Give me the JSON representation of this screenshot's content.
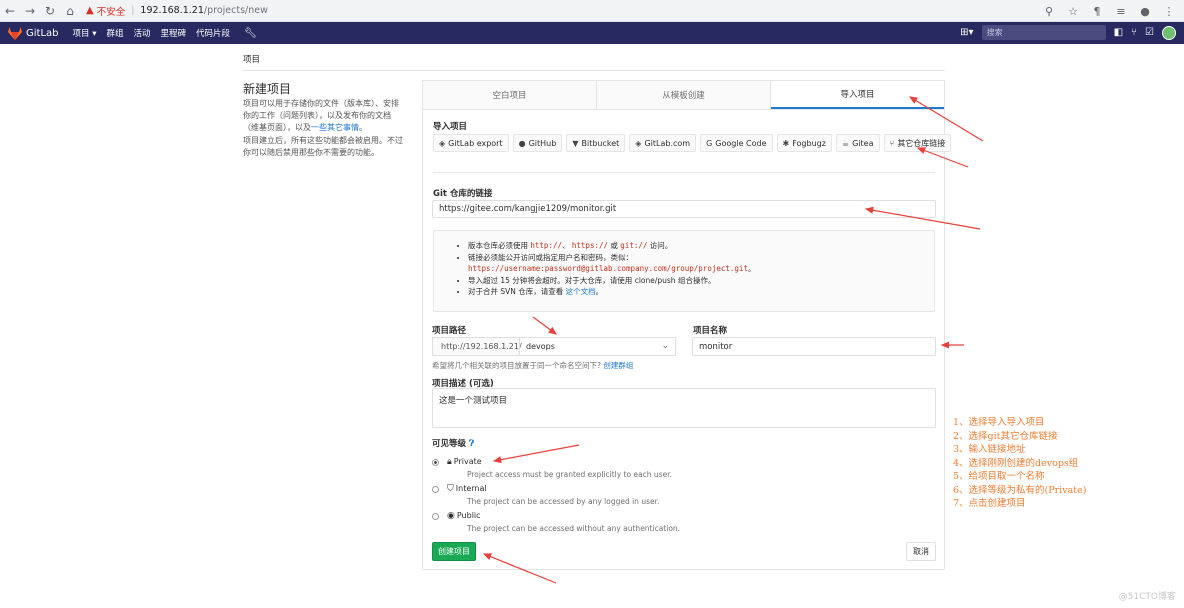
{
  "browser": {
    "insecure_label": "不安全",
    "url_host": "192.168.1.21",
    "url_path": "/projects/new"
  },
  "header": {
    "brand": "GitLab",
    "nav": [
      "项目 ▾",
      "群组",
      "活动",
      "里程碑",
      "代码片段"
    ],
    "search_placeholder": "搜索"
  },
  "breadcrumb": "项目",
  "left": {
    "title": "新建项目",
    "desc": "项目可以用于存储你的文件（版本库）、安排你的工作（问题列表），以及发布你的文档（维基页面），以及",
    "desc_link": "一些其它事情",
    "desc_end": "。",
    "desc2": "项目建立后，所有这些功能都会被启用。不过你可以随后禁用那些你不需要的功能。"
  },
  "tabs": [
    {
      "label": "空白项目",
      "active": false
    },
    {
      "label": "从模板创建",
      "active": false
    },
    {
      "label": "导入项目",
      "active": true
    }
  ],
  "import": {
    "label": "导入项目",
    "buttons": [
      {
        "label": "GitLab export",
        "icon": "gitlab-icon"
      },
      {
        "label": "GitHub",
        "icon": "github-icon"
      },
      {
        "label": "Bitbucket",
        "icon": "bitbucket-icon"
      },
      {
        "label": "GitLab.com",
        "icon": "gitlab-icon"
      },
      {
        "label": "Google Code",
        "icon": "google-icon"
      },
      {
        "label": "Fogbugz",
        "icon": "bug-icon"
      },
      {
        "label": "Gitea",
        "icon": "gitea-icon"
      },
      {
        "label": "其它仓库链接",
        "icon": "git-icon"
      }
    ]
  },
  "git_url": {
    "label": "Git 仓库的链接",
    "value": "https://gitee.com/kangjie1209/monitor.git"
  },
  "info": {
    "l1_a": "版本仓库必须使用",
    "l1_c1": "http://",
    "l1_b": "、",
    "l1_c2": "https://",
    "l1_c": "或",
    "l1_c3": "git://",
    "l1_d": "访问。",
    "l2": "链接必须能公开访问或指定用户名和密码，类似：",
    "l2_code": "https://username:password@gitlab.company.com/group/project.git",
    "l2_end": "。",
    "l3": "导入超过 15 分钟将会超时。对于大仓库，请使用 clone/push 组合操作。",
    "l4": "对于合并 SVN 仓库，请查看",
    "l4_link": "这个文档",
    "l4_end": "。"
  },
  "path": {
    "label": "项目路径",
    "prefix": "http://192.168.1.21/",
    "namespace": "devops",
    "hint": "希望将几个相关联的项目放置于同一个命名空间下?",
    "hint_link": "创建群组"
  },
  "name": {
    "label": "项目名称",
    "value": "monitor"
  },
  "desc": {
    "label": "项目描述 (可选)",
    "value": "这是一个测试项目"
  },
  "visibility": {
    "label": "可见等级",
    "options": [
      {
        "title": "Private",
        "desc": "Project access must be granted explicitly to each user.",
        "icon": "lock-icon",
        "checked": true
      },
      {
        "title": "Internal",
        "desc": "The project can be accessed by any logged in user.",
        "icon": "shield-icon",
        "checked": false
      },
      {
        "title": "Public",
        "desc": "The project can be accessed without any authentication.",
        "icon": "globe-icon",
        "checked": false
      }
    ]
  },
  "actions": {
    "create": "创建项目",
    "cancel": "取消"
  },
  "annotations": [
    "1、选择导入导入项目",
    "2、选择git其它仓库链接",
    "3、输入链接地址",
    "4、选择刚刚创建的devops组",
    "5、给项目取一个名称",
    "6、选择等级为私有的(Private)",
    "7、点击创建项目"
  ],
  "watermark": "@51CTO博客",
  "colors": {
    "header": "#292961",
    "primary": "#1f78d1",
    "success": "#1aaa55",
    "annotation": "#ee7d31",
    "arrow": "#e8403a"
  }
}
